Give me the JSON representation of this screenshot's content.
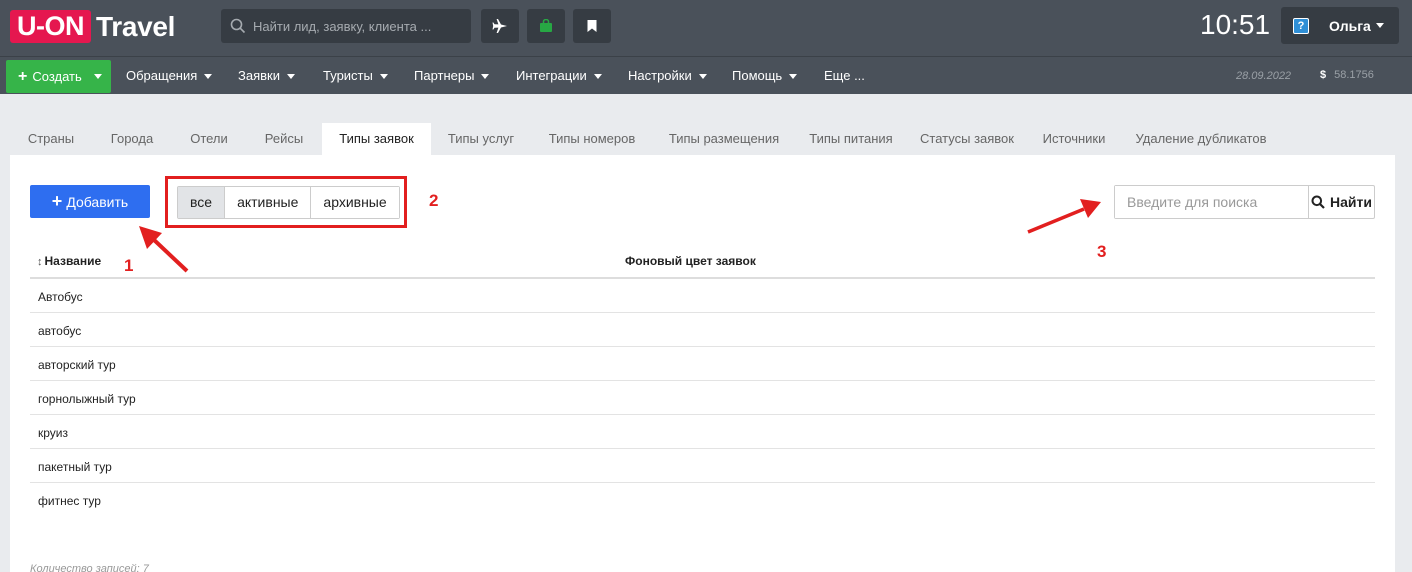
{
  "app": {
    "logo_box": "U-ON",
    "logo_text": "Travel"
  },
  "topbar": {
    "search_placeholder": "Найти лид, заявку, клиента ...",
    "clock": "10:51",
    "user_name": "Ольга",
    "help_glyph": "?"
  },
  "nav": {
    "create_label": "Создать",
    "items": [
      "Обращения",
      "Заявки",
      "Туристы",
      "Партнеры",
      "Интеграции",
      "Настройки",
      "Помощь",
      "Еще ..."
    ],
    "date": "28.09.2022",
    "currency_symbol": "$",
    "rate": "58.1756"
  },
  "tabs": [
    "Страны",
    "Города",
    "Отели",
    "Рейсы",
    "Типы заявок",
    "Типы услуг",
    "Типы номеров",
    "Типы размещения",
    "Типы питания",
    "Статусы заявок",
    "Источники",
    "Удаление дубликатов"
  ],
  "active_tab": "Типы заявок",
  "toolbar": {
    "add_label": "Добавить",
    "filters": [
      "все",
      "активные",
      "архивные"
    ],
    "active_filter": "все",
    "search_placeholder": "Введите для поиска",
    "search_button": "Найти"
  },
  "table": {
    "columns": [
      "Название",
      "Фоновый цвет заявок"
    ],
    "rows": [
      "Автобус",
      "автобус",
      "авторский тур",
      "горнолыжный тур",
      "круиз",
      "пакетный тур",
      "фитнес тур"
    ]
  },
  "footer": {
    "count_text": "Количество записей: 7"
  },
  "annotations": {
    "n1": "1",
    "n2": "2",
    "n3": "3"
  },
  "colors": {
    "brand": "#e5174f",
    "topbar": "#4a515a",
    "create": "#36b449",
    "add": "#2e6ef0",
    "annotation": "#e21f1f"
  }
}
